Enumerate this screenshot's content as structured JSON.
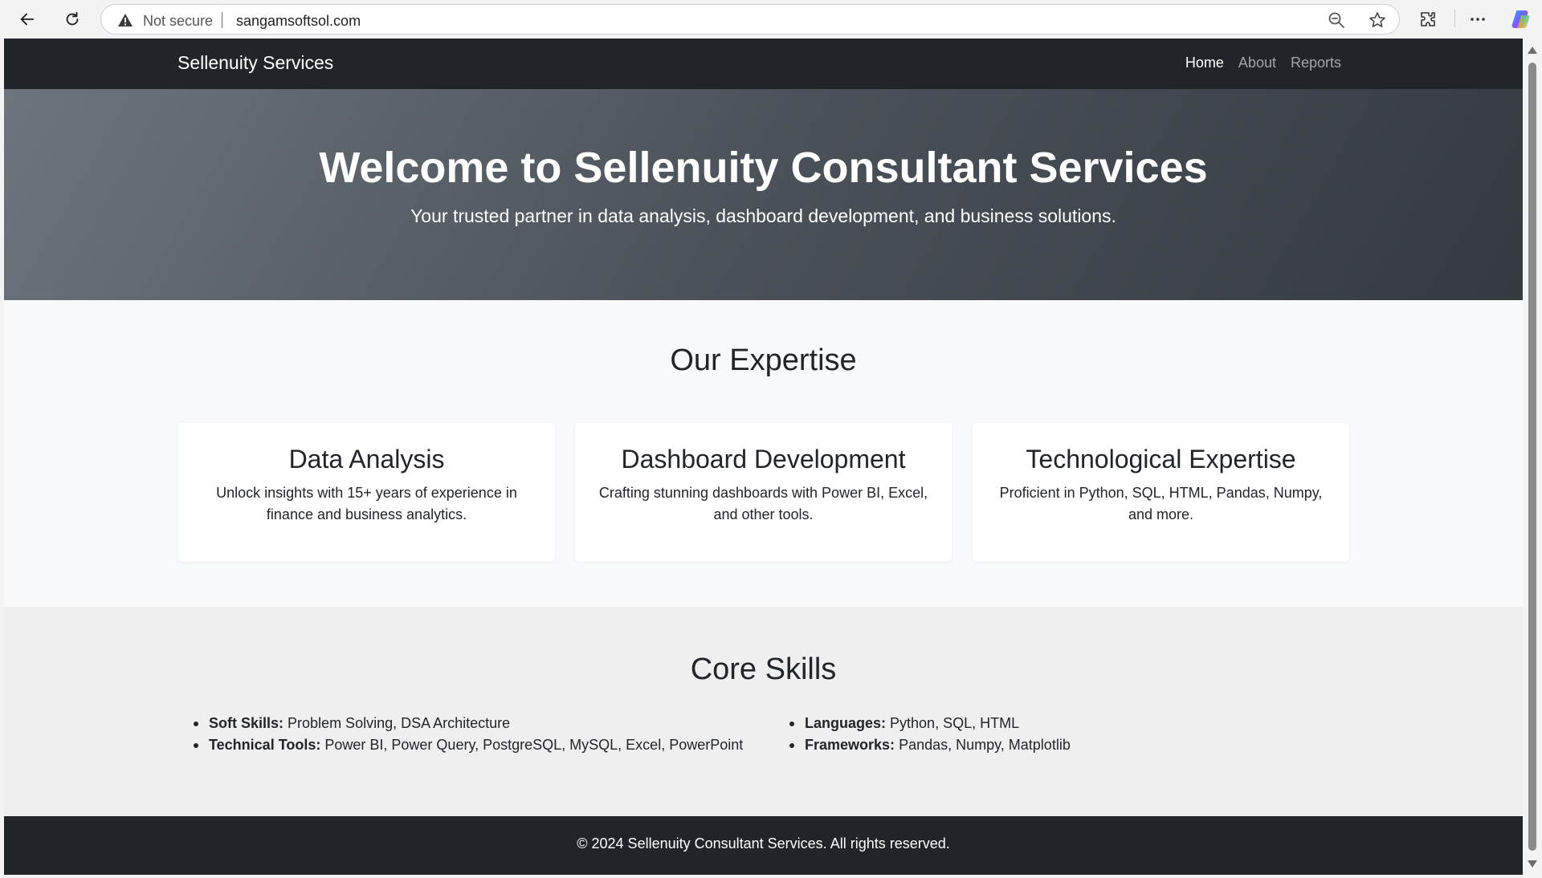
{
  "browser": {
    "security_label": "Not secure",
    "url": "sangamsoftsol.com"
  },
  "navbar": {
    "brand": "Sellenuity Services",
    "links": [
      {
        "label": "Home",
        "active": true
      },
      {
        "label": "About",
        "active": false
      },
      {
        "label": "Reports",
        "active": false
      }
    ]
  },
  "hero": {
    "title": "Welcome to Sellenuity Consultant Services",
    "subtitle": "Your trusted partner in data analysis, dashboard development, and business solutions."
  },
  "expertise": {
    "title": "Our Expertise",
    "cards": [
      {
        "title": "Data Analysis",
        "text": "Unlock insights with 15+ years of experience in finance and business analytics."
      },
      {
        "title": "Dashboard Development",
        "text": "Crafting stunning dashboards with Power BI, Excel, and other tools."
      },
      {
        "title": "Technological Expertise",
        "text": "Proficient in Python, SQL, HTML, Pandas, Numpy, and more."
      }
    ]
  },
  "skills": {
    "title": "Core Skills",
    "left": [
      {
        "label": "Soft Skills:",
        "value": "Problem Solving, DSA Architecture"
      },
      {
        "label": "Technical Tools:",
        "value": "Power BI, Power Query, PostgreSQL, MySQL, Excel, PowerPoint"
      }
    ],
    "right": [
      {
        "label": "Languages:",
        "value": "Python, SQL, HTML"
      },
      {
        "label": "Frameworks:",
        "value": "Pandas, Numpy, Matplotlib"
      }
    ]
  },
  "footer": {
    "text": "© 2024 Sellenuity Consultant Services. All rights reserved."
  },
  "icons": [
    "back-arrow-icon",
    "refresh-icon",
    "warning-icon",
    "zoom-out-icon",
    "star-icon",
    "extensions-icon",
    "more-icon",
    "copilot-icon"
  ]
}
